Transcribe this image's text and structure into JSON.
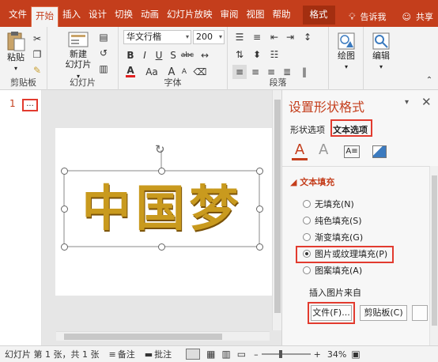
{
  "menu": {
    "tabs": [
      "文件",
      "开始",
      "插入",
      "设计",
      "切换",
      "动画",
      "幻灯片放映",
      "审阅",
      "视图",
      "帮助"
    ],
    "active_tab": "开始",
    "format_tab": "格式",
    "tell_me": "告诉我",
    "share": "共享"
  },
  "ribbon": {
    "clipboard": {
      "paste": "粘贴",
      "label": "剪贴板"
    },
    "slides": {
      "new_slide_line1": "新建",
      "new_slide_line2": "幻灯片",
      "label": "幻灯片"
    },
    "font": {
      "family": "华文行楷",
      "size": "200",
      "label": "字体",
      "bold": "B",
      "italic": "I",
      "underline": "U",
      "shadow": "S",
      "strike": "abc",
      "font_color": "A",
      "aa": "Aa",
      "grow": "A",
      "shrink": "A"
    },
    "paragraph": {
      "label": "段落"
    },
    "drawing": {
      "label": "绘图"
    },
    "editing": {
      "label": "编辑"
    }
  },
  "thumbs": {
    "slide_number": "1",
    "placeholder": "..."
  },
  "slide": {
    "text": "中国梦"
  },
  "panel": {
    "title": "设置形状格式",
    "tabs": [
      "形状选项",
      "文本选项"
    ],
    "active_tab": "文本选项",
    "section": "文本填充",
    "options": [
      "无填充(N)",
      "纯色填充(S)",
      "渐变填充(G)",
      "图片或纹理填充(P)",
      "图案填充(A)"
    ],
    "selected": "图片或纹理填充(P)",
    "insert_from": "插入图片来自",
    "file_button": "文件(F)...",
    "clipboard_button": "剪贴板(C)"
  },
  "status": {
    "slide_info": "幻灯片 第 1 张，共 1 张",
    "notes": "备注",
    "comments": "批注",
    "zoom": "34%"
  },
  "colors": {
    "accent": "#c43e1c",
    "highlight": "#e23b2f",
    "gold": "#c99a1e"
  }
}
